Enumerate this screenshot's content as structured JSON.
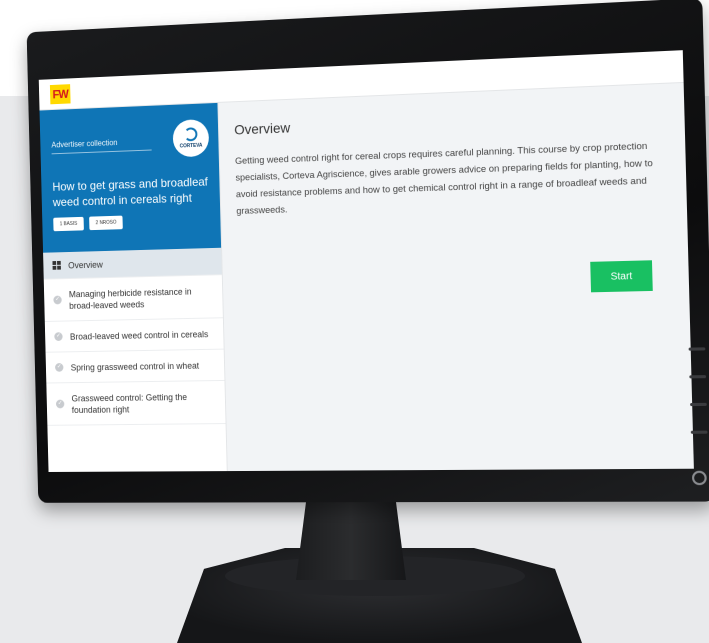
{
  "app": {
    "logo_text": "FW"
  },
  "sidebar": {
    "hero": {
      "tag": "Advertiser collection",
      "sponsor": "CORTEVA",
      "title": "How to get grass and broadleaf weed control in cereals right",
      "pills": [
        "1 BASIS",
        "2 NROSO"
      ]
    },
    "items": [
      {
        "label": "Overview",
        "active": true
      },
      {
        "label": "Managing herbicide resistance in broad-leaved weeds",
        "active": false
      },
      {
        "label": "Broad-leaved weed control in cereals",
        "active": false
      },
      {
        "label": "Spring grassweed control in wheat",
        "active": false
      },
      {
        "label": "Grassweed control: Getting the foundation right",
        "active": false
      }
    ]
  },
  "main": {
    "heading": "Overview",
    "body": "Getting weed control right for cereal crops requires careful planning. This course by crop protection specialists, Corteva Agriscience, gives  arable growers advice on preparing fields for planting, how to avoid resistance problems and how to get chemical control right in a range of broadleaf weeds and grassweeds.",
    "start_label": "Start"
  },
  "colors": {
    "hero_bg": "#0f75b6",
    "start_bg": "#19c062",
    "logo_bg": "#ffd900",
    "logo_fg": "#d4161c"
  }
}
